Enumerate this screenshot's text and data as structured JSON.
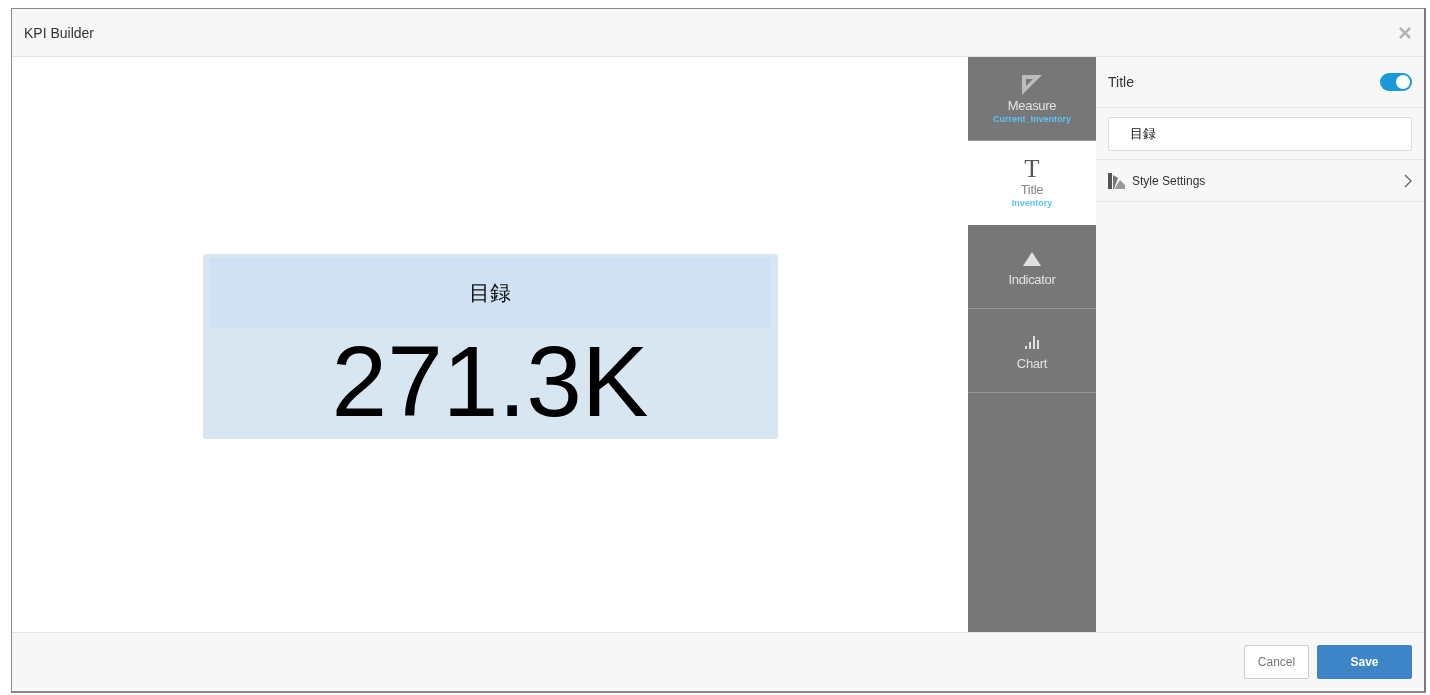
{
  "dialog": {
    "title": "KPI Builder"
  },
  "preview": {
    "kpi_title": "目録",
    "kpi_value": "271.3K"
  },
  "nav_tabs": [
    {
      "kind": "measure",
      "label": "Measure",
      "sublabel": "Current_Inventory",
      "selected": false
    },
    {
      "kind": "title",
      "glyph": "T",
      "label": "Title",
      "sublabel": "Inventory",
      "selected": true
    },
    {
      "kind": "indicator",
      "label": "Indicator",
      "selected": false
    },
    {
      "kind": "chart",
      "label": "Chart",
      "selected": false
    }
  ],
  "settings": {
    "title_label": "Title",
    "title_toggle": {
      "on": true
    },
    "title_input": {
      "value": "目録"
    },
    "style_settings": "Style Settings"
  },
  "footer": {
    "buttons": [
      {
        "kind": "secondary",
        "label": "Cancel"
      },
      {
        "kind": "primary",
        "label": "Save"
      }
    ]
  }
}
